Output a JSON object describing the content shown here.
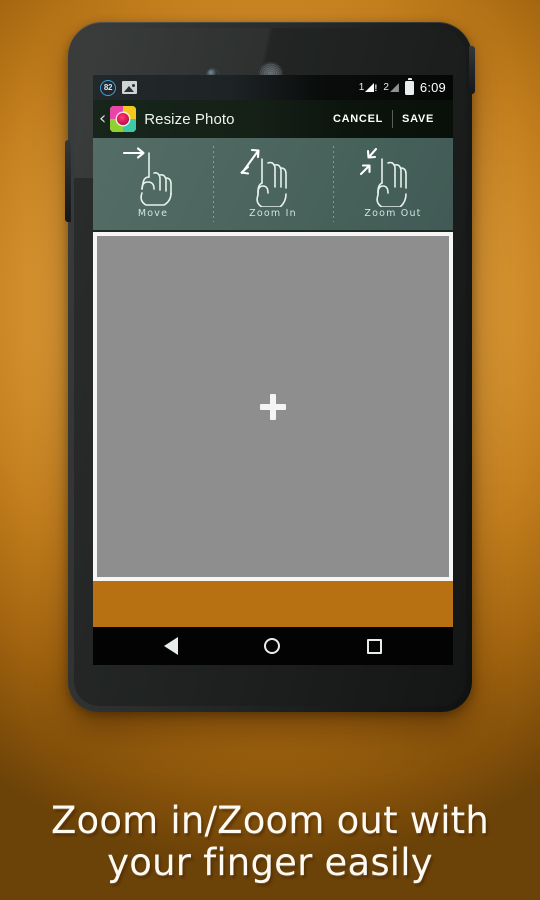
{
  "promo": {
    "tagline_line1": "Zoom in/Zoom out with",
    "tagline_line2": "your finger easily",
    "background_color": "#c47f1e",
    "accent_color": "#b87112"
  },
  "device": {
    "body_color": "#232625",
    "front_camera": "front-camera",
    "earpiece": "earpiece-speaker",
    "volume_rocker": "volume-rocker-button",
    "power_button": "power-button"
  },
  "status_bar": {
    "notification_badge": "82",
    "gallery_icon": "gallery-notification-icon",
    "sim1_label": "1",
    "sim1_alert": "!",
    "sim2_label": "2",
    "battery_icon": "battery-full-icon",
    "clock": "6:09",
    "background_color": "#1e2325"
  },
  "app_bar": {
    "back_label": "‹",
    "app_icon": "resize-photo-app-icon",
    "title": "Resize Photo",
    "cancel_label": "CANCEL",
    "save_label": "SAVE",
    "background_color": "#142118"
  },
  "gesture_hints": {
    "background_color": "#4d6660",
    "items": [
      {
        "label": "Move",
        "icon": "one-finger-drag-icon"
      },
      {
        "label": "Zoom In",
        "icon": "pinch-out-icon"
      },
      {
        "label": "Zoom Out",
        "icon": "pinch-in-icon"
      }
    ]
  },
  "editor": {
    "canvas_color": "#8e8e8e",
    "canvas_border_color": "#f6f6f6",
    "add_photo_icon": "plus-icon",
    "bottom_bar_color": "#b87112"
  },
  "nav_bar": {
    "background_color": "#030303",
    "back_icon": "nav-back-triangle-icon",
    "home_icon": "nav-home-circle-icon",
    "recents_icon": "nav-recents-square-icon"
  }
}
